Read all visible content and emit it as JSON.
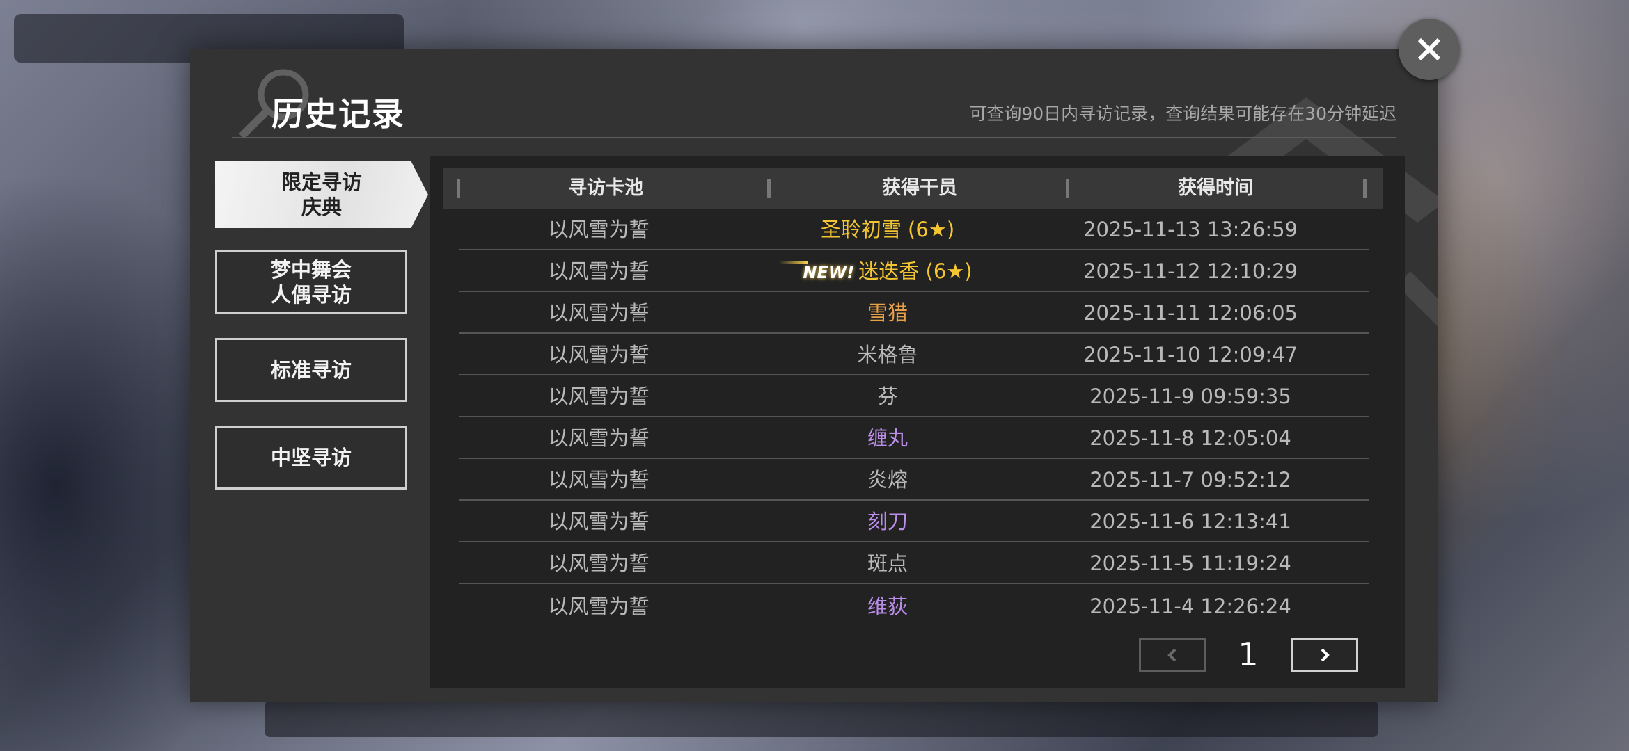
{
  "header": {
    "title": "历史记录",
    "subtitle": "可查询90日内寻访记录，查询结果可能存在30分钟延迟"
  },
  "tabs": [
    {
      "label": "限定寻访\n庆典",
      "active": true
    },
    {
      "label": "梦中舞会\n人偶寻访",
      "active": false
    },
    {
      "label": "标准寻访",
      "active": false
    },
    {
      "label": "中坚寻访",
      "active": false
    }
  ],
  "table": {
    "headers": [
      "寻访卡池",
      "获得干员",
      "获得时间"
    ],
    "rows": [
      {
        "pool": "以风雪为誓",
        "operator": "圣聆初雪 (6★)",
        "time": "2025-11-13 13:26:59",
        "new": "",
        "color": "#f3c531"
      },
      {
        "pool": "以风雪为誓",
        "operator": "迷迭香 (6★)",
        "time": "2025-11-12 12:10:29",
        "new": "NEW!",
        "color": "#f3c531"
      },
      {
        "pool": "以风雪为誓",
        "operator": "雪猎",
        "time": "2025-11-11 12:06:05",
        "new": "",
        "color": "#e7a048"
      },
      {
        "pool": "以风雪为誓",
        "operator": "米格鲁",
        "time": "2025-11-10 12:09:47",
        "new": "",
        "color": "#b9b9b9"
      },
      {
        "pool": "以风雪为誓",
        "operator": "芬",
        "time": "2025-11-9 09:59:35",
        "new": "",
        "color": "#b9b9b9"
      },
      {
        "pool": "以风雪为誓",
        "operator": "缠丸",
        "time": "2025-11-8 12:05:04",
        "new": "",
        "color": "#b98de8"
      },
      {
        "pool": "以风雪为誓",
        "operator": "炎熔",
        "time": "2025-11-7 09:52:12",
        "new": "",
        "color": "#b9b9b9"
      },
      {
        "pool": "以风雪为誓",
        "operator": "刻刀",
        "time": "2025-11-6 12:13:41",
        "new": "",
        "color": "#b98de8"
      },
      {
        "pool": "以风雪为誓",
        "operator": "斑点",
        "time": "2025-11-5 11:19:24",
        "new": "",
        "color": "#b9b9b9"
      },
      {
        "pool": "以风雪为誓",
        "operator": "维荻",
        "time": "2025-11-4 12:26:24",
        "new": "",
        "color": "#b98de8"
      }
    ]
  },
  "pagination": {
    "current_page": "1"
  },
  "icons": {
    "close": "close-icon",
    "prev": "chevron-left-icon",
    "next": "chevron-right-icon",
    "magnifier": "magnifier-icon"
  }
}
